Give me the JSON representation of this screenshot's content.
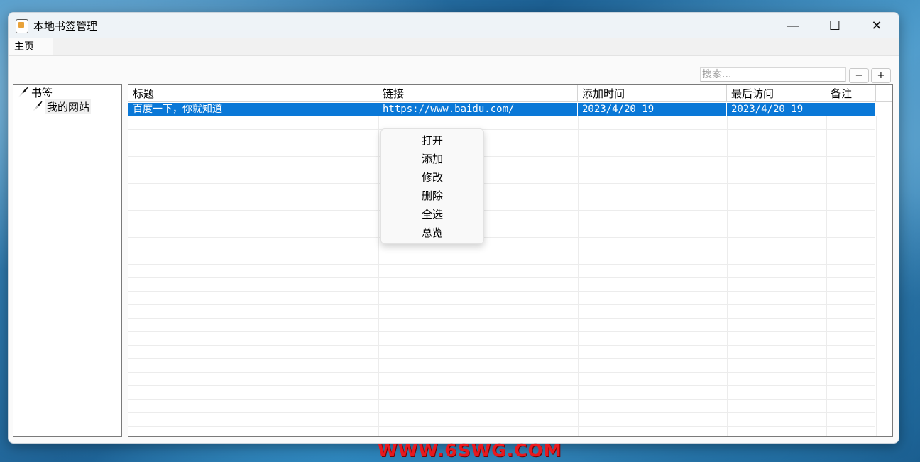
{
  "window": {
    "title": "本地书签管理",
    "minimize": "—",
    "maximize": "☐",
    "close": "✕"
  },
  "tabs": [
    {
      "label": "主页"
    }
  ],
  "search": {
    "placeholder": "搜索..."
  },
  "buttons": {
    "collapse": "−",
    "expand": "+"
  },
  "tree": {
    "root": "书签",
    "child": "我的网站"
  },
  "table": {
    "columns": [
      "标题",
      "链接",
      "添加时间",
      "最后访问",
      "备注"
    ],
    "rows": [
      {
        "title": "百度一下，你就知道",
        "url": "https://www.baidu.com/",
        "added": "2023/4/20 19",
        "visited": "2023/4/20 19",
        "note": ""
      }
    ]
  },
  "context_menu": [
    "打开",
    "添加",
    "修改",
    "删除",
    "全选",
    "总览"
  ],
  "watermark": "WWW.6SWG.COM",
  "colors": {
    "selection": "#0a78d7",
    "watermark": "#e8191f"
  }
}
